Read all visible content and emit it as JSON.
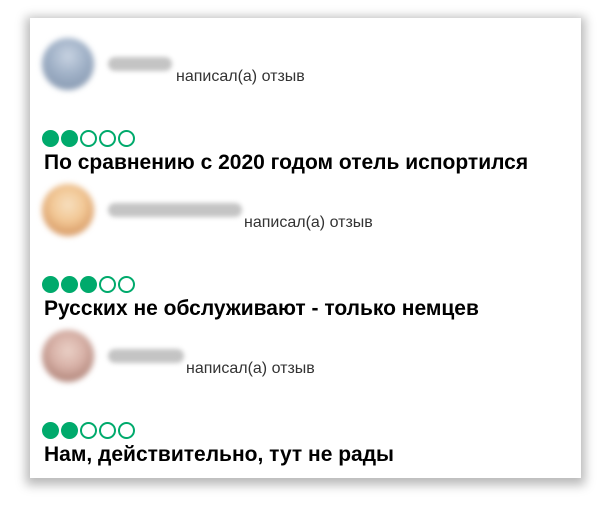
{
  "reviews": [
    {
      "action_text": "написал(а) отзыв",
      "rating": 2,
      "max_rating": 5,
      "title": "По сравнению с 2020 годом отель испортился",
      "avatar_colors": [
        "#c8d3e2",
        "#7d8fa8"
      ]
    },
    {
      "action_text": "написал(а) отзыв",
      "rating": 3,
      "max_rating": 5,
      "title": "Русских не обслуживают - только немцев",
      "avatar_colors": [
        "#f2c896",
        "#c77d47"
      ]
    },
    {
      "action_text": "написал(а) отзыв",
      "rating": 2,
      "max_rating": 5,
      "title": "Нам, действительно, тут не рады",
      "avatar_colors": [
        "#d8b2a8",
        "#9a6a5e"
      ]
    }
  ],
  "colors": {
    "rating_green": "#00aa6c",
    "blurred_name": "#c4c4c4"
  }
}
